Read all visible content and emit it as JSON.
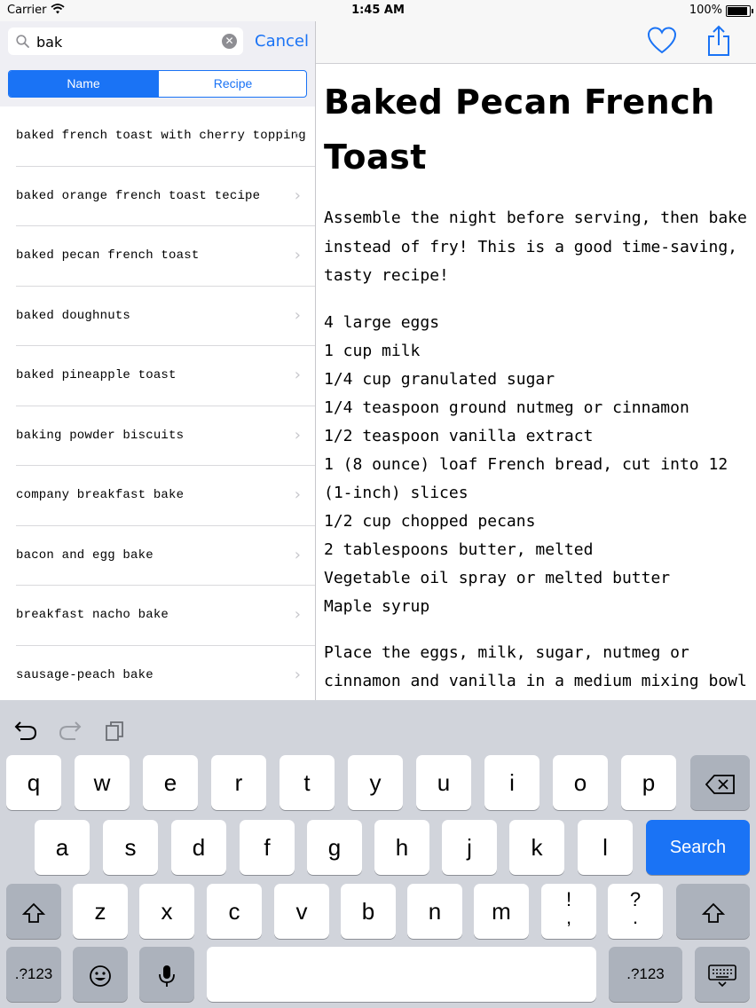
{
  "status_bar": {
    "carrier": "Carrier",
    "time": "1:45 AM",
    "battery": "100%"
  },
  "search": {
    "value": "bak",
    "cancel_label": "Cancel"
  },
  "segments": [
    {
      "label": "Name",
      "selected": true
    },
    {
      "label": "Recipe",
      "selected": false
    }
  ],
  "results": [
    "baked french toast with cherry topping",
    "baked orange french toast tecipe",
    "baked pecan french toast",
    "baked doughnuts",
    "baked pineapple toast",
    "baking powder biscuits",
    "company breakfast bake",
    "bacon and egg bake",
    "breakfast nacho bake",
    "sausage-peach bake"
  ],
  "icons": {
    "favorite": "heart-icon",
    "share": "share-icon",
    "undo": "undo-icon",
    "redo": "redo-icon",
    "paste": "clipboard-icon"
  },
  "recipe": {
    "title": "Baked Pecan French Toast",
    "intro": "Assemble the night before serving, then bake instead of fry! This is a good time-saving, tasty recipe!",
    "ingredients": [
      "4 large eggs",
      "1 cup milk",
      "1/4 cup granulated sugar",
      "1/4 teaspoon ground nutmeg or cinnamon",
      "1/2 teaspoon vanilla extract",
      "1 (8 ounce) loaf French bread, cut into 12 (1-inch) slices",
      "1/2 cup chopped pecans",
      "2 tablespoons butter, melted",
      "Vegetable oil spray or melted butter",
      "Maple syrup"
    ],
    "steps": "Place the eggs, milk, sugar, nutmeg or cinnamon and vanilla in a medium mixing bowl and whisk to"
  },
  "keyboard": {
    "row1": [
      "q",
      "w",
      "e",
      "r",
      "t",
      "y",
      "u",
      "i",
      "o",
      "p"
    ],
    "row2": [
      "a",
      "s",
      "d",
      "f",
      "g",
      "h",
      "j",
      "k",
      "l"
    ],
    "row3": [
      "z",
      "x",
      "c",
      "v",
      "b",
      "n",
      "m"
    ],
    "punct1_top": "!",
    "punct1_bottom": ",",
    "punct2_top": "?",
    "punct2_bottom": ".",
    "search_label": "Search",
    "numbers_label": ".?123"
  },
  "colors": {
    "accent": "#1a73f5",
    "keyboard_bg": "#d1d4db"
  }
}
